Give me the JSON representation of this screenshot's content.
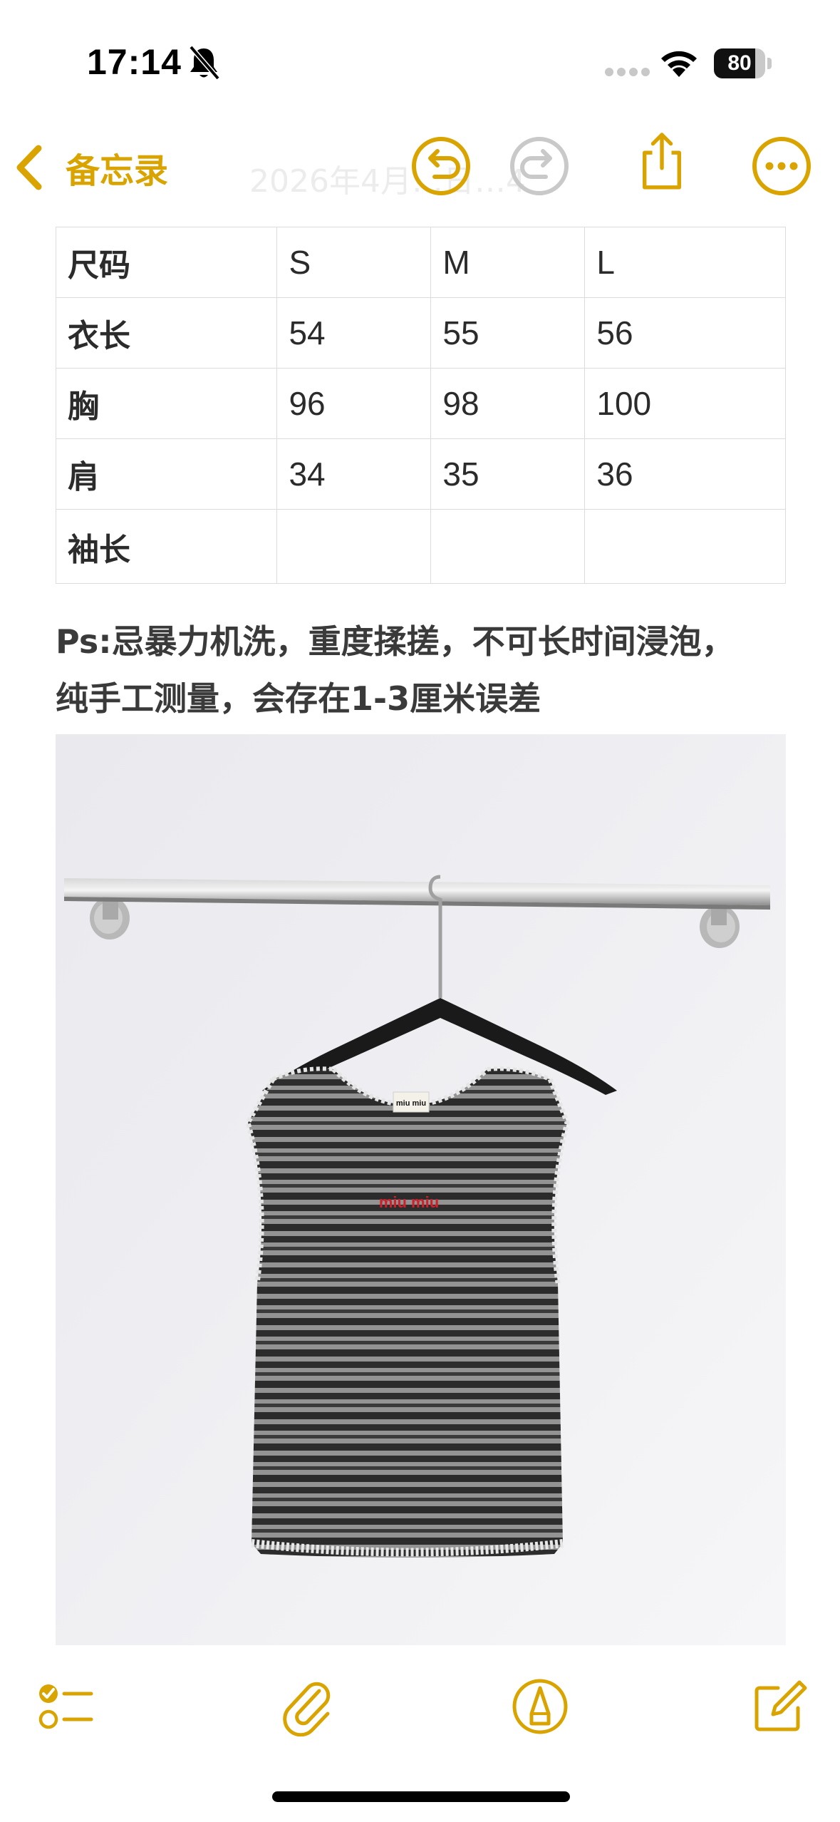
{
  "status_bar": {
    "time": "17:14",
    "battery_level": "80",
    "battery_fraction": 0.8
  },
  "nav": {
    "back_label": "备忘录",
    "faded_title": "2026年4月…日…4"
  },
  "table": {
    "rows": [
      [
        "尺码",
        "S",
        "M",
        "L"
      ],
      [
        "衣长",
        "54",
        "55",
        "56"
      ],
      [
        "胸",
        "96",
        "98",
        "100"
      ],
      [
        "肩",
        "34",
        "35",
        "36"
      ],
      [
        "袖长",
        "",
        "",
        ""
      ]
    ]
  },
  "note": {
    "line1": "Ps:忌暴力机洗，重度揉搓，不可长时间浸泡，",
    "line2": "纯手工测量，会存在1-3厘米误差"
  },
  "photo": {
    "label_text": "miu miu",
    "logo_text": "miu miu"
  },
  "colors": {
    "accent": "#d9a400",
    "text": "#2b2b2b",
    "table_border": "#dcdcdc",
    "logo_red": "#d0202a"
  },
  "icons": {
    "back": "chevron-left-icon",
    "undo": "undo-icon",
    "redo": "redo-icon",
    "share": "share-icon",
    "more": "more-icon",
    "checklist": "checklist-icon",
    "attach": "paperclip-icon",
    "markup": "markup-pen-icon",
    "compose": "compose-icon"
  }
}
